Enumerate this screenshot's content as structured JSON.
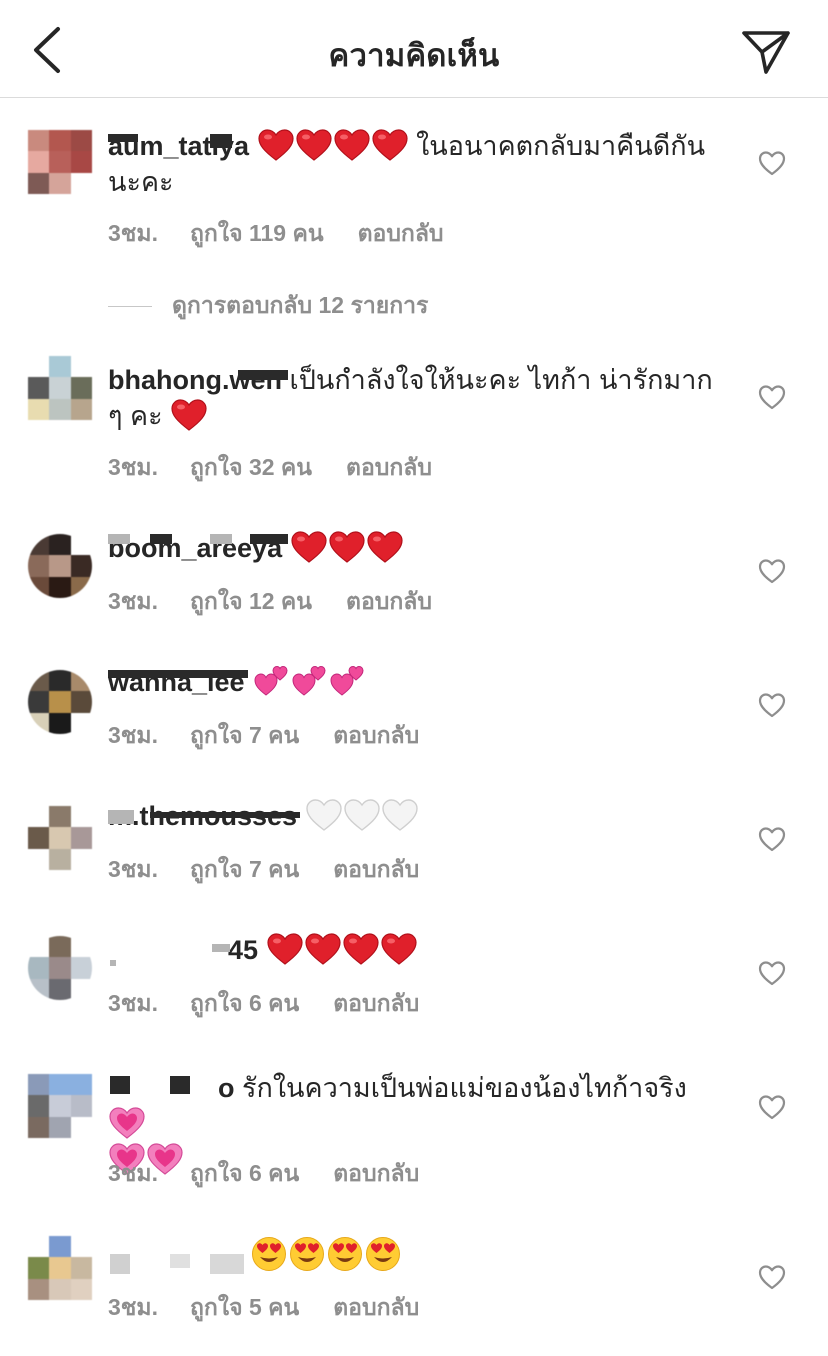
{
  "header": {
    "title": "ความคิดเห็น"
  },
  "view_replies_label": "ดูการตอบกลับ 12 รายการ",
  "comments": [
    {
      "username": "aum_tatiya",
      "text": "ในอนาคตกลับมาคืนดีกัน นะคะ",
      "text_line1": "ในอนาคตกลับมาคืนดีกัน",
      "text_line2": "นะคะ",
      "emoji_before": "red-heart x4",
      "time": "3ชม.",
      "likes": "ถูกใจ 119 คน",
      "reply": "ตอบกลับ"
    },
    {
      "username": "bhahong.wen",
      "text_line1": "เป็นกำลังใจให้นะคะ ไทก้า น่ารักมาก",
      "text_line2": "ๆ คะ",
      "emoji_after": "red-heart x1",
      "time": "3ชม.",
      "likes": "ถูกใจ 32 คน",
      "reply": "ตอบกลับ"
    },
    {
      "username": "boom_areeya",
      "emoji_after": "red-heart x3",
      "time": "3ชม.",
      "likes": "ถูกใจ 12 คน",
      "reply": "ตอบกลับ"
    },
    {
      "username": "wanna_lee",
      "emoji_after": "two-hearts x3",
      "time": "3ชม.",
      "likes": "ถูกใจ 7 คน",
      "reply": "ตอบกลับ"
    },
    {
      "username": "m.themousses",
      "emoji_after": "white-heart x3",
      "time": "3ชม.",
      "likes": "ถูกใจ 7 คน",
      "reply": "ตอบกลับ"
    },
    {
      "username": "45",
      "emoji_after": "red-heart x4",
      "time": "3ชม.",
      "likes": "ถูกใจ 6 คน",
      "reply": "ตอบกลับ"
    },
    {
      "username": "o",
      "text_line1": "รักในความเป็นพ่อแม่ของน้องไทก้าจริง",
      "emoji_after": "growing-heart x3",
      "time": "3ชม.",
      "likes": "ถูกใจ 6 คน",
      "reply": "ตอบกลับ"
    },
    {
      "username": "",
      "emoji_after": "heart-eyes x4",
      "time": "3ชม.",
      "likes": "ถูกใจ 5 คน",
      "reply": "ตอบกลับ"
    }
  ],
  "colors": {
    "text": "#262626",
    "meta": "#8e8e8e",
    "divider": "#dbdbdb",
    "red_heart": "#e0202b",
    "pink_heart": "#f04a9a"
  },
  "icons": {
    "back": "chevron-left-icon",
    "share": "paper-plane-icon",
    "like": "heart-outline-icon"
  }
}
